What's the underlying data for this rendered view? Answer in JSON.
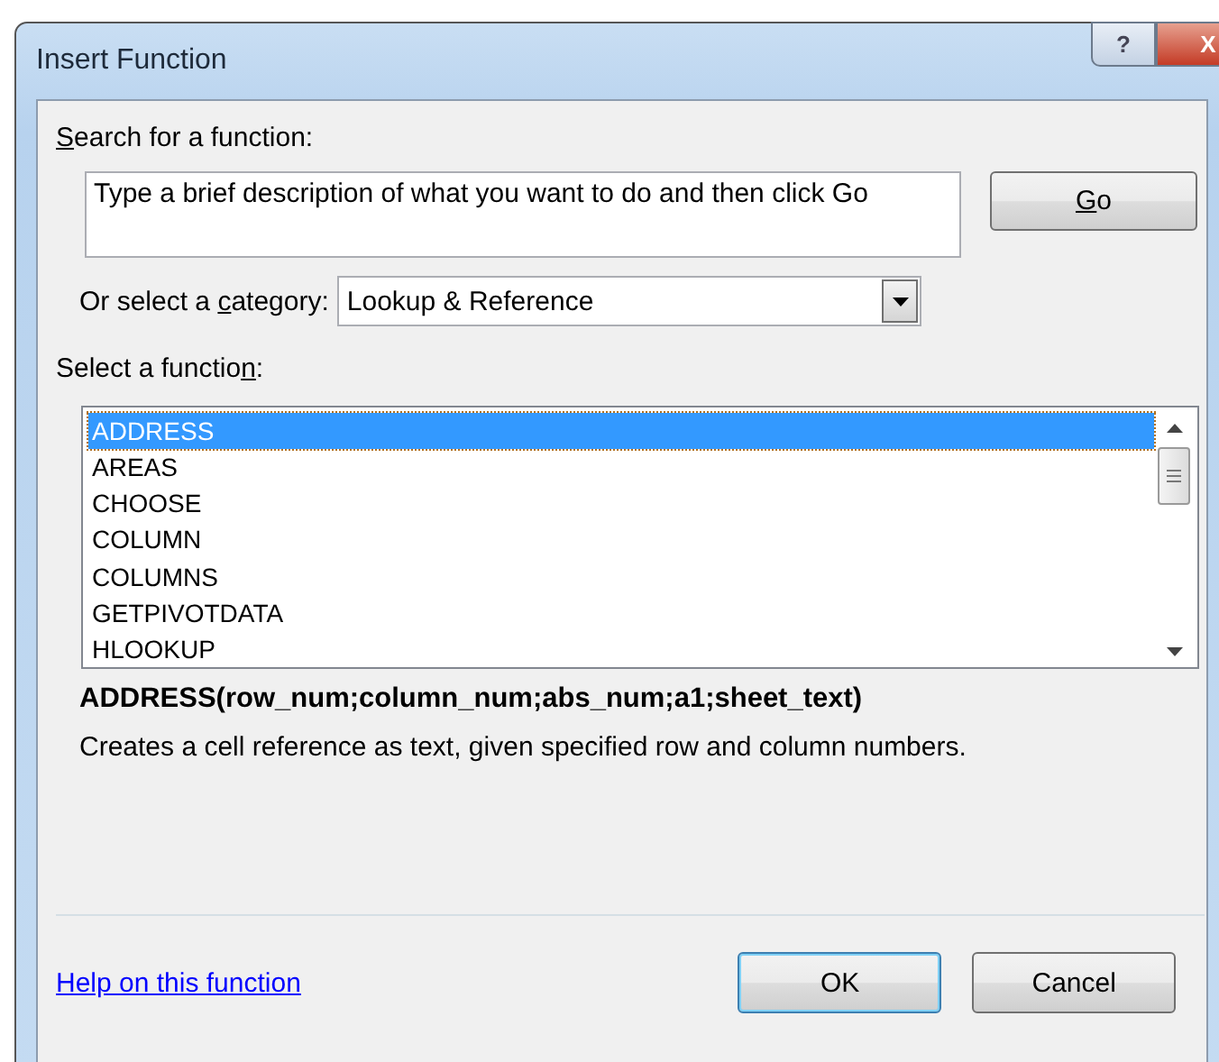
{
  "window": {
    "title": "Insert Function",
    "help_button": "?",
    "close_button": "X"
  },
  "search": {
    "label_parts": {
      "key": "S",
      "after": "earch for a function:"
    },
    "placeholder": "Type a brief description of what you want to do and then click Go",
    "go_button_parts": {
      "key": "G",
      "after": "o"
    }
  },
  "category": {
    "label_parts": {
      "before": "Or select a ",
      "key": "c",
      "after": "ategory:"
    },
    "value": "Lookup & Reference"
  },
  "functions": {
    "label_parts": {
      "before": "Select a functio",
      "key": "n",
      "after": ":"
    },
    "items": [
      {
        "name": "ADDRESS",
        "selected": true
      },
      {
        "name": "AREAS",
        "selected": false
      },
      {
        "name": "CHOOSE",
        "selected": false
      },
      {
        "name": "COLUMN",
        "selected": false
      },
      {
        "name": "COLUMNS",
        "selected": false
      },
      {
        "name": "GETPIVOTDATA",
        "selected": false
      },
      {
        "name": "HLOOKUP",
        "selected": false
      }
    ]
  },
  "signature": "ADDRESS(row_num;column_num;abs_num;a1;sheet_text)",
  "description": "Creates a cell reference as text, given specified row and column numbers.",
  "help_link": "Help on this function",
  "buttons": [
    {
      "label": "OK",
      "default": true
    },
    {
      "label": "Cancel",
      "default": false
    }
  ]
}
